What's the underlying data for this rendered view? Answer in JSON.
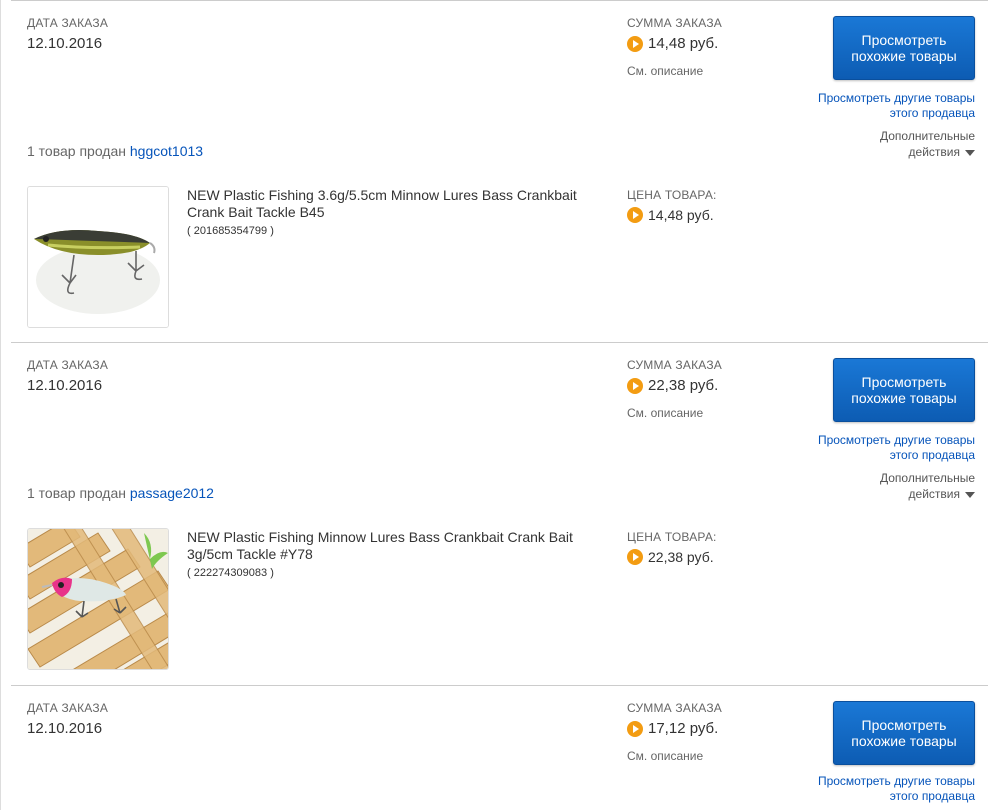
{
  "orders": [
    {
      "date_label": "ДАТА ЗАКАЗА",
      "date": "12.10.2016",
      "total_label": "СУММА ЗАКАЗА",
      "total": "14,48 руб.",
      "see_description": "См. описание",
      "similar_button": "Просмотреть похожие товары",
      "other_items_link": "Просмотреть другие товары этого продавца",
      "more_actions": "Дополнительные действия",
      "seller_prefix": "1 товар продан",
      "seller": "hggcot1013",
      "item": {
        "title": "NEW Plastic Fishing 3.6g/5.5cm Minnow Lures Bass Crankbait Crank Bait Tackle B45",
        "id": "( 201685354799 )",
        "price_label": "ЦЕНА ТОВАРА:",
        "price": "14,48 руб."
      }
    },
    {
      "date_label": "ДАТА ЗАКАЗА",
      "date": "12.10.2016",
      "total_label": "СУММА ЗАКАЗА",
      "total": "22,38 руб.",
      "see_description": "См. описание",
      "similar_button": "Просмотреть похожие товары",
      "other_items_link": "Просмотреть другие товары этого продавца",
      "more_actions": "Дополнительные действия",
      "seller_prefix": "1 товар продан",
      "seller": "passage2012",
      "item": {
        "title": "NEW Plastic Fishing Minnow Lures Bass Crankbait Crank Bait 3g/5cm Tackle #Y78",
        "id": "( 222274309083 )",
        "price_label": "ЦЕНА ТОВАРА:",
        "price": "22,38 руб."
      }
    },
    {
      "date_label": "ДАТА ЗАКАЗА",
      "date": "12.10.2016",
      "total_label": "СУММА ЗАКАЗА",
      "total": "17,12 руб.",
      "see_description": "См. описание",
      "similar_button": "Просмотреть похожие товары",
      "other_items_link": "Просмотреть другие товары этого продавца"
    }
  ],
  "colors": {
    "link": "#0654ba",
    "button": "#0d5cb3",
    "price_icon": "#f39c12"
  },
  "icons": {
    "price": "price-play-icon",
    "dropdown": "caret-down-icon"
  }
}
